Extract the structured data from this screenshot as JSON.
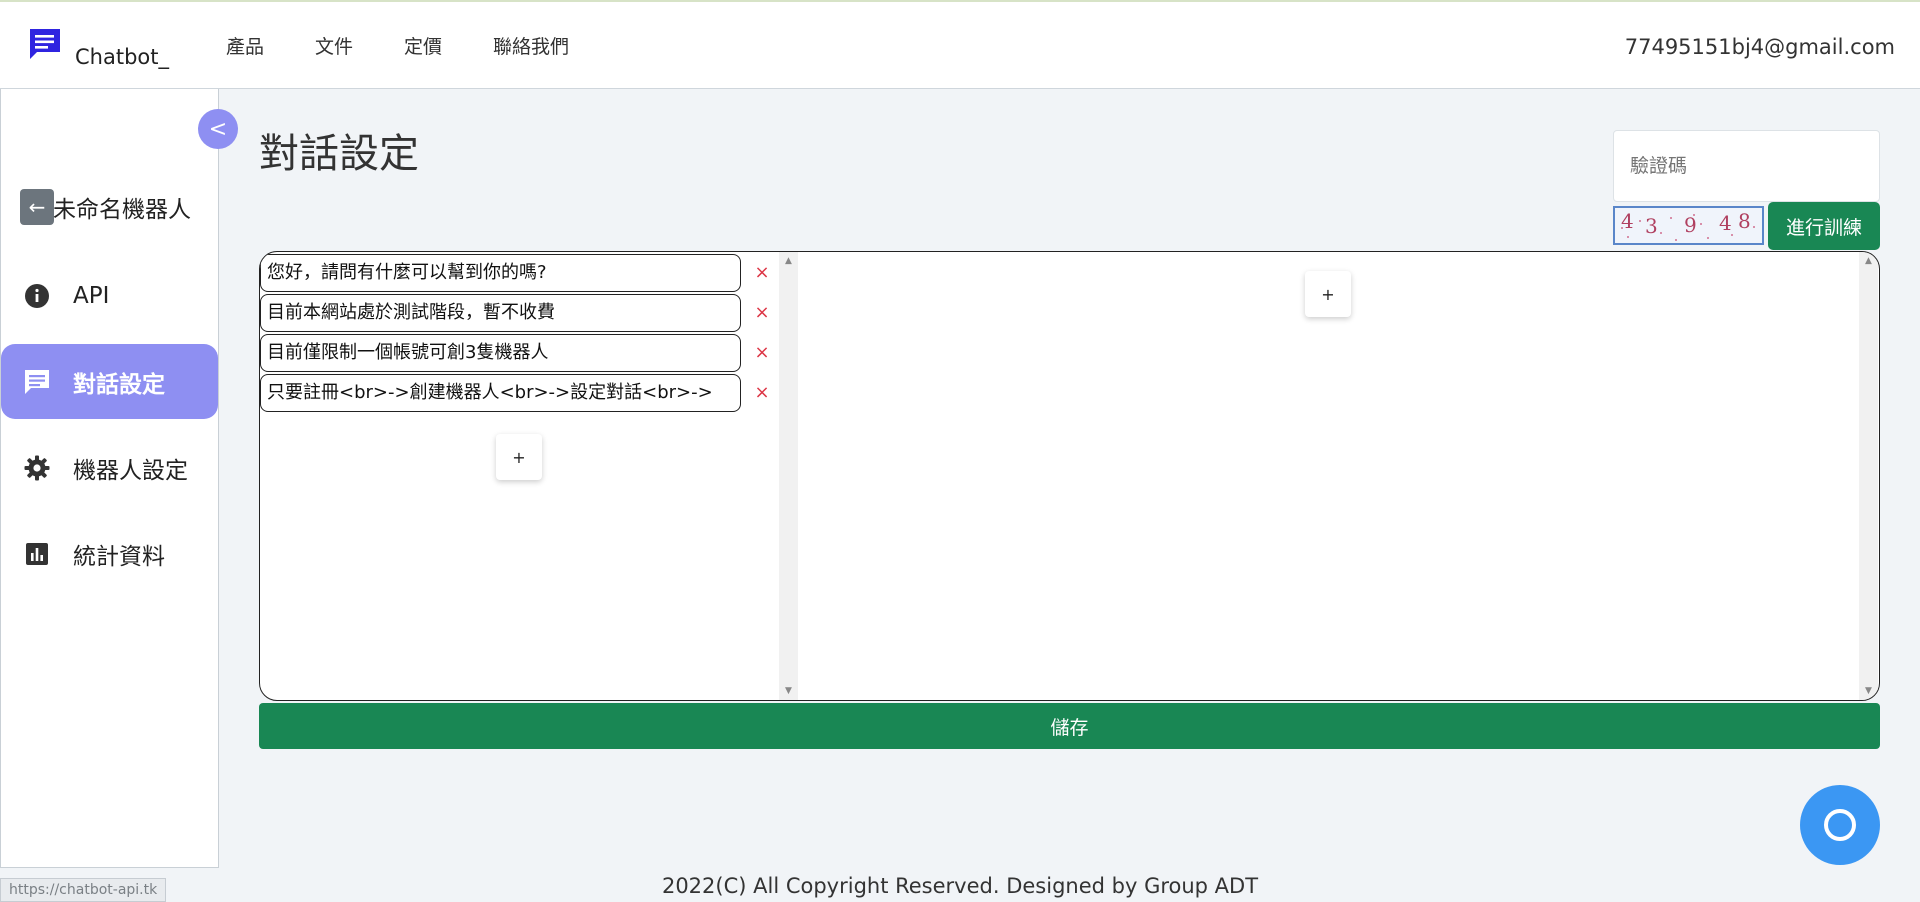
{
  "header": {
    "brand": "Chatbot_",
    "nav": [
      "產品",
      "文件",
      "定價",
      "聯絡我們"
    ],
    "email": "77495151bj4@gmail.com"
  },
  "sidebar": {
    "collapse_label": "<",
    "back_label": "←",
    "bot_name": "未命名機器人",
    "items": [
      {
        "label": "API",
        "icon": "info-icon"
      },
      {
        "label": "對話設定",
        "icon": "chat-icon",
        "active": true
      },
      {
        "label": "機器人設定",
        "icon": "gear-icon"
      },
      {
        "label": "統計資料",
        "icon": "bar-chart-icon"
      }
    ]
  },
  "main": {
    "title": "對話設定",
    "captcha_placeholder": "驗證碼",
    "captcha_digits": [
      "4",
      "3",
      "9",
      "4",
      "8"
    ],
    "train_label": "進行訓練",
    "questions": [
      "您好，請問有什麼可以幫到你的嗎?",
      "目前本網站處於測試階段，暫不收費",
      "目前僅限制一個帳號可創3隻機器人",
      "只要註冊<br>->創建機器人<br>->設定對話<br>->"
    ],
    "delete_label": "×",
    "add_label": "+",
    "save_label": "儲存"
  },
  "footer": {
    "copyright": "2022(C) All Copyright Reserved. Designed by Group ADT",
    "status_url": "https://chatbot-api.tk"
  },
  "colors": {
    "accent": "#8e8ff2",
    "success": "#198754",
    "danger": "#dc3545",
    "fab": "#3b97f3"
  }
}
